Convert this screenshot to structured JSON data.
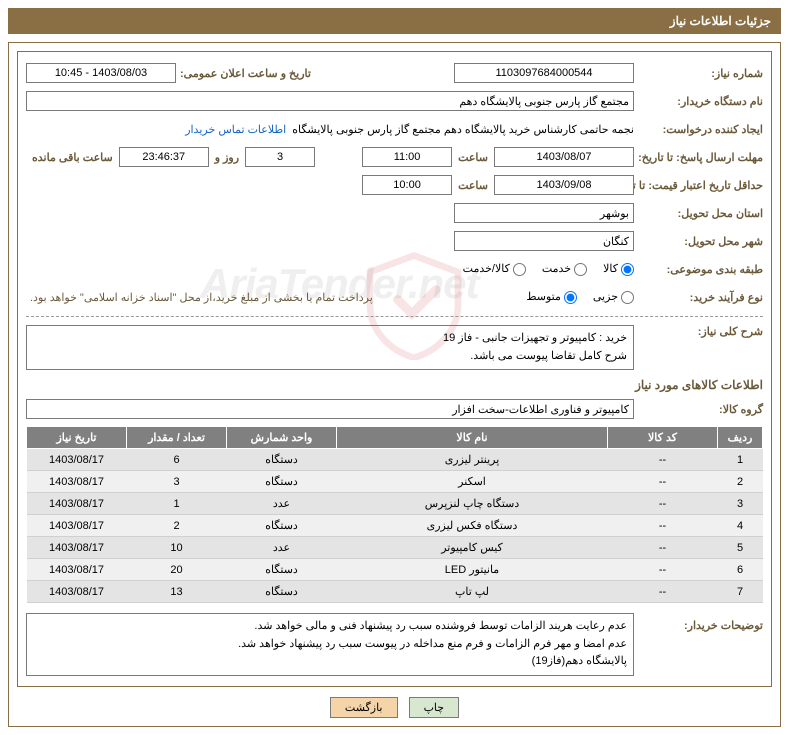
{
  "title": "جزئیات اطلاعات نیاز",
  "labels": {
    "need_no": "شماره نیاز:",
    "announce": "تاریخ و ساعت اعلان عمومی:",
    "buyer_org": "نام دستگاه خریدار:",
    "requester": "ایجاد کننده درخواست:",
    "contact_link": "اطلاعات تماس خریدار",
    "reply_deadline": "مهلت ارسال پاسخ: تا تاریخ:",
    "hour": "ساعت",
    "days_and": "روز و",
    "remaining": "ساعت باقی مانده",
    "price_validity": "حداقل تاریخ اعتبار قیمت: تا تاریخ:",
    "delivery_province": "استان محل تحویل:",
    "delivery_city": "شهر محل تحویل:",
    "subject_class": "طبقه بندی موضوعی:",
    "r_goods": "کالا",
    "r_service": "خدمت",
    "r_goods_service": "کالا/خدمت",
    "buy_process": "نوع فرآیند خرید:",
    "r_partial": "جزیی",
    "r_medium": "متوسط",
    "pay_note": "پرداخت تمام یا بخشی از مبلغ خرید،از محل \"اسناد خزانه اسلامی\" خواهد بود.",
    "overall_need": "شرح کلی نیاز:",
    "items_info": "اطلاعات کالاهای مورد نیاز",
    "goods_group": "گروه کالا:",
    "buyer_remarks": "توضیحات خریدار:",
    "th_row": "ردیف",
    "th_code": "کد کالا",
    "th_name": "نام کالا",
    "th_unit": "واحد شمارش",
    "th_qty": "تعداد / مقدار",
    "th_date": "تاریخ نیاز",
    "btn_print": "چاپ",
    "btn_back": "بازگشت"
  },
  "fields": {
    "need_no": "1103097684000544",
    "announce": "1403/08/03 - 10:45",
    "buyer_org": "مجتمع گاز پارس جنوبی  پالایشگاه دهم",
    "requester": "نجمه حاتمی کارشناس خرید پالایشگاه دهم  مجتمع گاز پارس جنوبی  پالایشگاه",
    "reply_date": "1403/08/07",
    "reply_time": "11:00",
    "remain_days": "3",
    "remain_time": "23:46:37",
    "price_date": "1403/09/08",
    "price_time": "10:00",
    "province": "بوشهر",
    "city": "کنگان",
    "overall_line1": "خرید : کامپیوتر و تجهیزات جانبی - فاز 19",
    "overall_line2": "شرح کامل تقاضا پیوست می باشد.",
    "goods_group": "کامپیوتر و فناوری اطلاعات-سخت افزار",
    "remarks_l1": "عدم رعایت هریند الزامات توسط فروشنده سبب رد پیشنهاد فنی و مالی خواهد شد.",
    "remarks_l2": "عدم امضا و مهر فرم الزامات و فرم منع مداخله در پیوست سبب رد پیشنهاد خواهد شد.",
    "remarks_l3": "پالایشگاه دهم(فاز19)"
  },
  "items": [
    {
      "row": "1",
      "code": "--",
      "name": "پرینتر لیزری",
      "unit": "دستگاه",
      "qty": "6",
      "date": "1403/08/17"
    },
    {
      "row": "2",
      "code": "--",
      "name": "اسکنر",
      "unit": "دستگاه",
      "qty": "3",
      "date": "1403/08/17"
    },
    {
      "row": "3",
      "code": "--",
      "name": "دستگاه چاپ لنزپرس",
      "unit": "عدد",
      "qty": "1",
      "date": "1403/08/17"
    },
    {
      "row": "4",
      "code": "--",
      "name": "دستگاه فکس لیزری",
      "unit": "دستگاه",
      "qty": "2",
      "date": "1403/08/17"
    },
    {
      "row": "5",
      "code": "--",
      "name": "کیس کامپیوتر",
      "unit": "عدد",
      "qty": "10",
      "date": "1403/08/17"
    },
    {
      "row": "6",
      "code": "--",
      "name": "مانیتور LED",
      "unit": "دستگاه",
      "qty": "20",
      "date": "1403/08/17"
    },
    {
      "row": "7",
      "code": "--",
      "name": "لپ تاپ",
      "unit": "دستگاه",
      "qty": "13",
      "date": "1403/08/17"
    }
  ]
}
